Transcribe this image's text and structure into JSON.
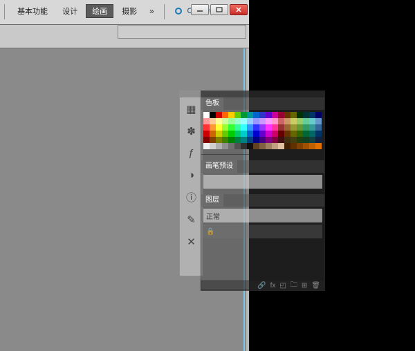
{
  "title_bar": {
    "workspace_tabs": [
      "基本功能",
      "设计",
      "绘画",
      "摄影"
    ],
    "workspace_active_index": 2,
    "more_indicator": "»",
    "cs_live_label": "CS Live",
    "cs_live_caret": "▾"
  },
  "panels": {
    "color_tab": "色板",
    "brush_preset_tab": "画笔预设",
    "mode_label": "正常",
    "layers_tab": "图层"
  },
  "swatch_rows": [
    [
      "#ffffff",
      "#000000",
      "#cc0000",
      "#ff6600",
      "#ffcc00",
      "#66cc00",
      "#009933",
      "#009999",
      "#0066cc",
      "#3333cc",
      "#6600cc",
      "#cc0099",
      "#990033",
      "#663300",
      "#666600",
      "#003300",
      "#003333",
      "#003366",
      "#000066"
    ],
    [
      "#ff9999",
      "#ffcc99",
      "#ffff99",
      "#ccff99",
      "#99ff99",
      "#99ffcc",
      "#99ffff",
      "#99ccff",
      "#9999ff",
      "#cc99ff",
      "#ff99ff",
      "#ff99cc",
      "#cc6666",
      "#cc9966",
      "#cccc66",
      "#99cc66",
      "#66cc99",
      "#66cccc",
      "#6699cc"
    ],
    [
      "#ff3333",
      "#ff9933",
      "#ffff33",
      "#99ff33",
      "#33ff33",
      "#33ff99",
      "#33ffff",
      "#3399ff",
      "#3333ff",
      "#9933ff",
      "#ff33ff",
      "#ff3399",
      "#993333",
      "#996633",
      "#999933",
      "#669933",
      "#339966",
      "#339999",
      "#336699"
    ],
    [
      "#cc0000",
      "#cc6600",
      "#cccc00",
      "#66cc00",
      "#00cc00",
      "#00cc66",
      "#00cccc",
      "#0066cc",
      "#0000cc",
      "#6600cc",
      "#cc00cc",
      "#cc0066",
      "#660000",
      "#663300",
      "#666600",
      "#336600",
      "#006633",
      "#006666",
      "#003366"
    ],
    [
      "#800000",
      "#804000",
      "#808000",
      "#408000",
      "#008000",
      "#008040",
      "#008080",
      "#004080",
      "#000080",
      "#400080",
      "#800080",
      "#800040",
      "#401010",
      "#403010",
      "#404010",
      "#204010",
      "#104020",
      "#104040",
      "#102040"
    ],
    [
      "#f0f0f0",
      "#d0d0d0",
      "#b0b0b0",
      "#909090",
      "#707070",
      "#505050",
      "#303030",
      "#101010",
      "#604020",
      "#806040",
      "#a08060",
      "#c0a080",
      "#e0c0a0",
      "#402000",
      "#603000",
      "#804000",
      "#a05000",
      "#c06000",
      "#e07000"
    ]
  ]
}
